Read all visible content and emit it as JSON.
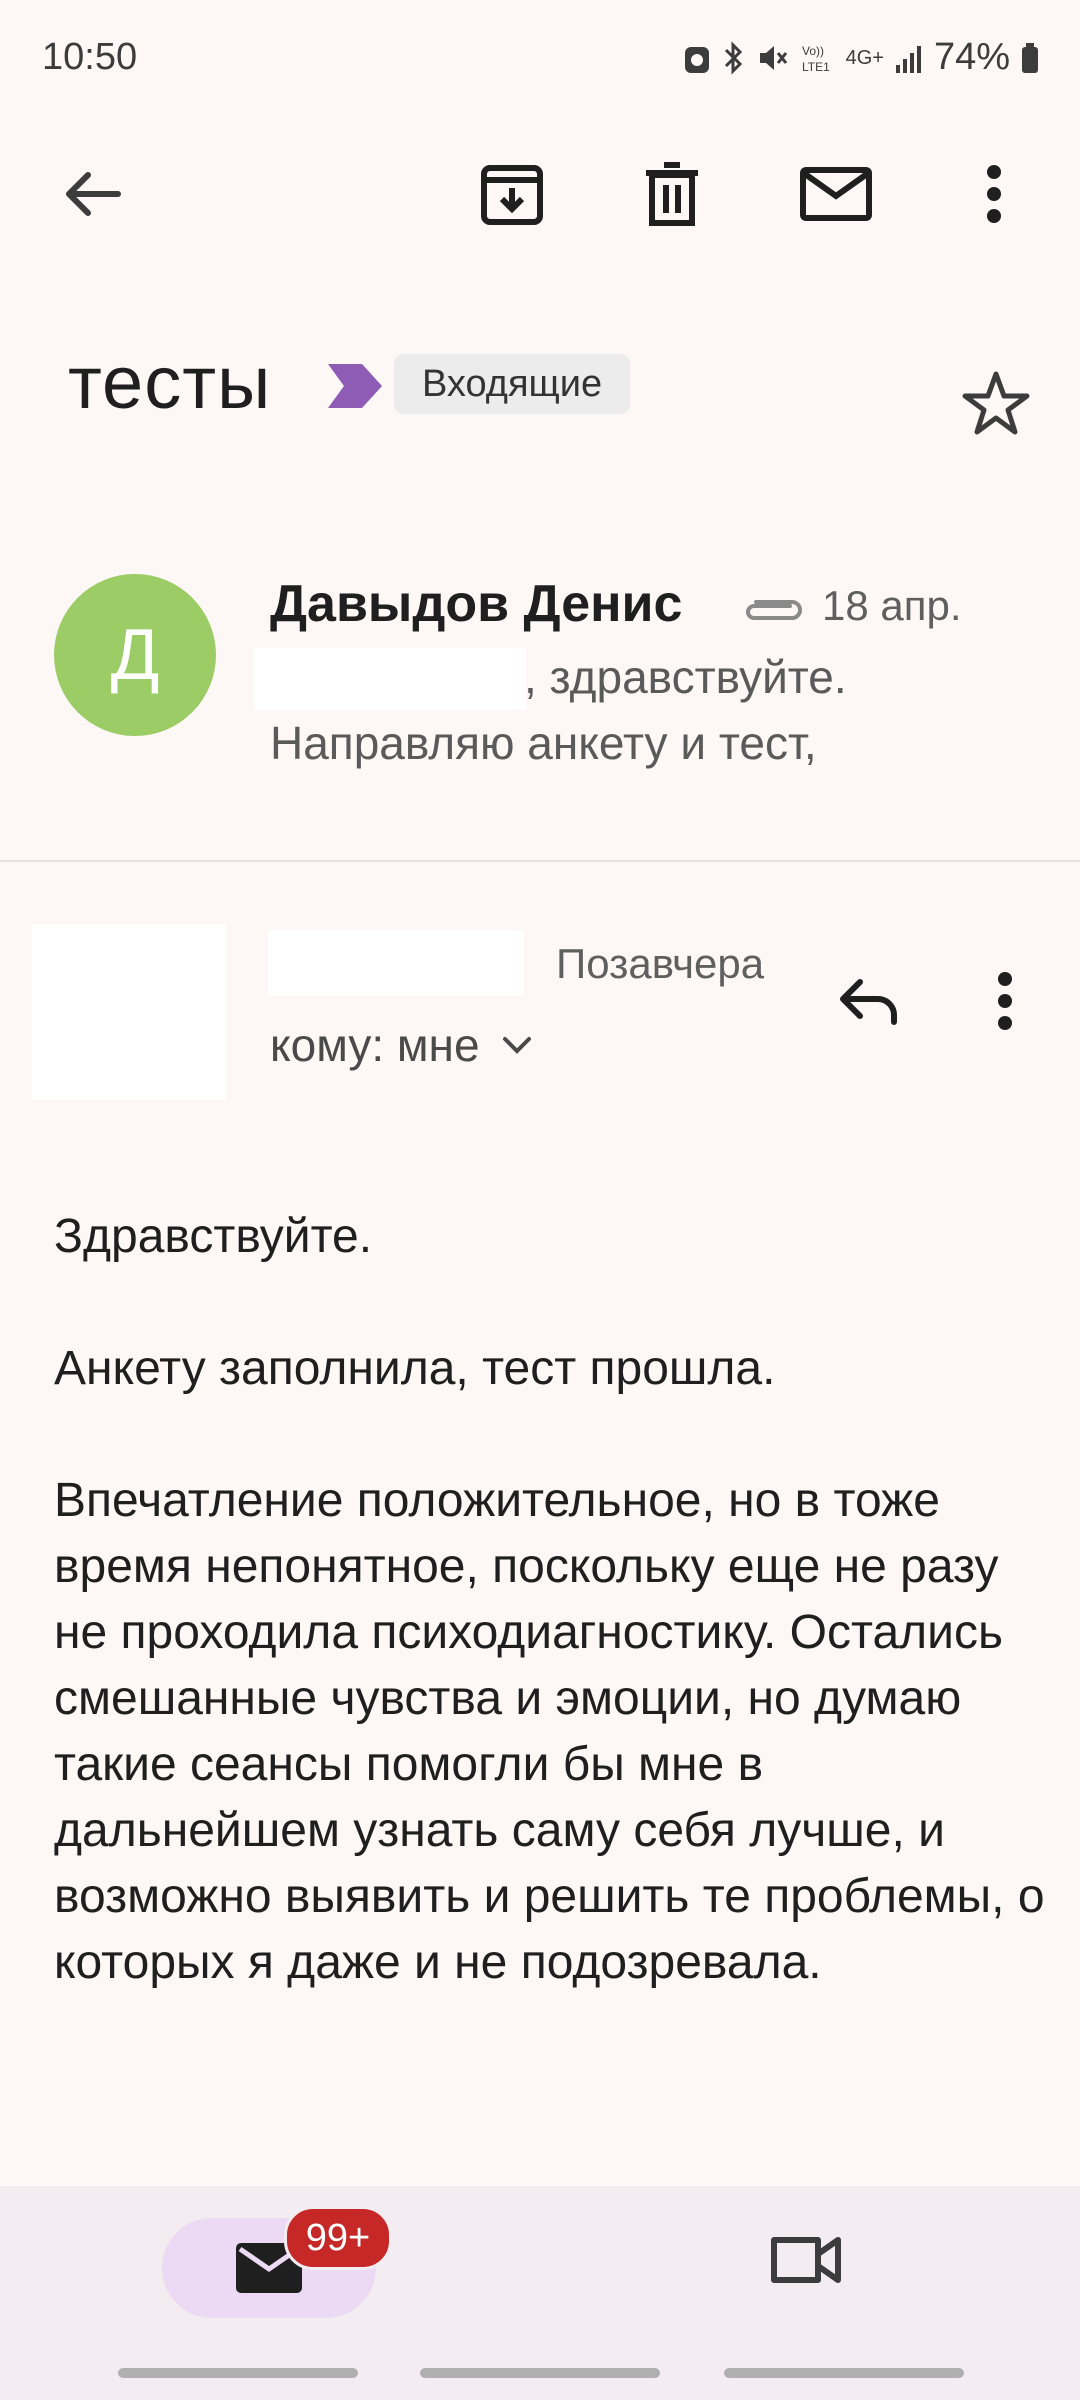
{
  "status_bar": {
    "time": "10:50",
    "battery": "74%",
    "network": "4G+"
  },
  "toolbar": {
    "icons": [
      "back-arrow-icon",
      "archive-icon",
      "trash-icon",
      "mail-unread-icon",
      "more-vert-icon"
    ]
  },
  "subject": {
    "title": "тесты",
    "folder": "Входящие",
    "label_color": "#8e5bb5"
  },
  "first_message": {
    "avatar_letter": "Д",
    "avatar_color": "#9ccc65",
    "sender": "Давыдов Денис",
    "date": "18 апр.",
    "snippet_line1": ", здравствуйте.",
    "snippet_line2": "Направляю анкету и тест,"
  },
  "second_message": {
    "date": "Позавчера",
    "to": "кому: мне"
  },
  "body": {
    "p1": "Здравствуйте.",
    "p2": "Анкету заполнила, тест прошла.",
    "p3": "Впечатление положительное, но в тоже время непонятное, поскольку еще не разу не проходила психодиагностику. Остались смешанные чувства и эмоции, но думаю такие сеансы помогли бы мне в дальнейшем узнать саму себя лучше, и возможно выявить и решить те проблемы, о которых я даже и не подозревала."
  },
  "bottom_nav": {
    "mail_badge": "99+"
  }
}
